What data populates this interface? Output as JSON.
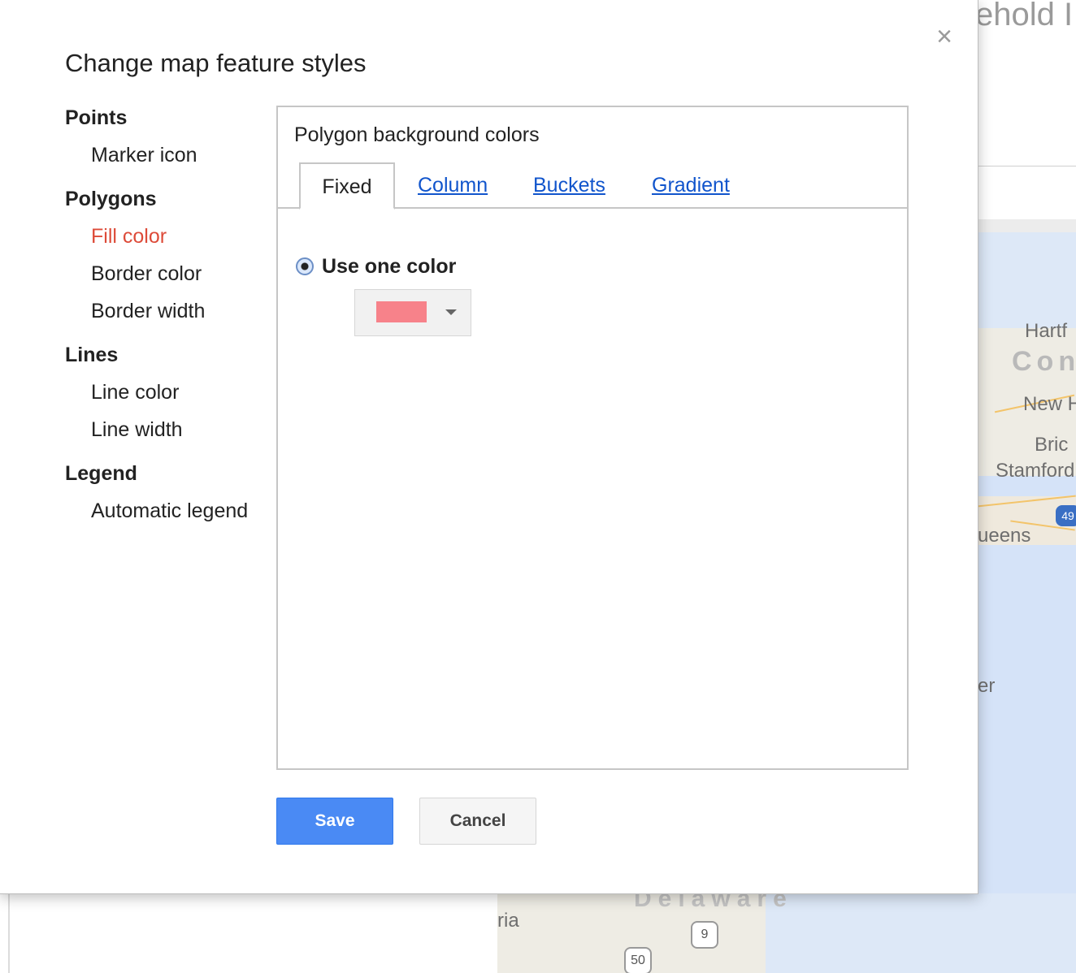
{
  "background": {
    "page_title_fragment": "ehold I",
    "map_labels_right": [
      "Hartf",
      "Con",
      "New H",
      "Bric",
      "Stamford",
      "ueens",
      "er"
    ],
    "map_shield_right": "49",
    "map_labels_bottom": [
      "Delaware",
      "ria"
    ],
    "map_shields_bottom": [
      "9",
      "50"
    ]
  },
  "dialog": {
    "title": "Change map feature styles",
    "close_glyph": "×",
    "nav": {
      "groups": [
        {
          "title": "Points",
          "items": [
            {
              "label": "Marker icon",
              "active": false
            }
          ]
        },
        {
          "title": "Polygons",
          "items": [
            {
              "label": "Fill color",
              "active": true
            },
            {
              "label": "Border color",
              "active": false
            },
            {
              "label": "Border width",
              "active": false
            }
          ]
        },
        {
          "title": "Lines",
          "items": [
            {
              "label": "Line color",
              "active": false
            },
            {
              "label": "Line width",
              "active": false
            }
          ]
        },
        {
          "title": "Legend",
          "items": [
            {
              "label": "Automatic legend",
              "active": false
            }
          ]
        }
      ]
    },
    "panel": {
      "heading": "Polygon background colors",
      "tabs": [
        {
          "label": "Fixed",
          "selected": true
        },
        {
          "label": "Column",
          "selected": false
        },
        {
          "label": "Buckets",
          "selected": false
        },
        {
          "label": "Gradient",
          "selected": false
        }
      ],
      "radio_label": "Use one color",
      "radio_checked": true,
      "color_value": "#f7828a"
    },
    "buttons": {
      "save": "Save",
      "cancel": "Cancel"
    }
  },
  "colors": {
    "accent_blue": "#4a8af4",
    "active_nav": "#dd4b39",
    "link": "#1155cc"
  }
}
